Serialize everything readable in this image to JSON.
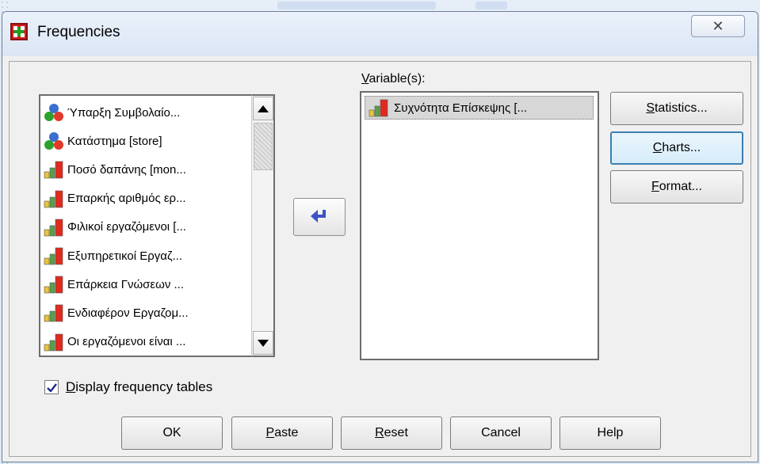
{
  "window": {
    "title": "Frequencies",
    "close_glyph": "✕"
  },
  "source_list": {
    "items": [
      {
        "label": "Ύπαρξη Συμβολαίο...",
        "icon": "nominal-variable-icon"
      },
      {
        "label": "Κατάστημα [store]",
        "icon": "nominal-variable-icon"
      },
      {
        "label": "Ποσό δαπάνης [mon...",
        "icon": "ordinal-variable-icon"
      },
      {
        "label": "Επαρκής αριθμός ερ...",
        "icon": "ordinal-variable-icon"
      },
      {
        "label": "Φιλικοί εργαζόμενοι [...",
        "icon": "ordinal-variable-icon"
      },
      {
        "label": "Εξυπηρετικοί Εργαζ...",
        "icon": "ordinal-variable-icon"
      },
      {
        "label": "Επάρκεια Γνώσεων ...",
        "icon": "ordinal-variable-icon"
      },
      {
        "label": "Ενδιαφέρον Εργαζομ...",
        "icon": "ordinal-variable-icon"
      },
      {
        "label": "Οι εργαζόμενοι είναι ...",
        "icon": "ordinal-variable-icon"
      }
    ]
  },
  "variables": {
    "label_u": "V",
    "label_rest": "ariable(s):",
    "items": [
      {
        "label": "Συχνότητα Επίσκεψης [...",
        "icon": "ordinal-variable-icon"
      }
    ]
  },
  "side_buttons": {
    "statistics": {
      "u": "S",
      "rest": "tatistics..."
    },
    "charts": {
      "u": "C",
      "rest": "harts..."
    },
    "format": {
      "u": "F",
      "rest": "ormat..."
    }
  },
  "checkbox": {
    "u": "D",
    "rest": "isplay frequency tables",
    "checked": true
  },
  "bottom_buttons": {
    "ok": "OK",
    "paste": {
      "u": "P",
      "rest": "aste"
    },
    "reset": {
      "u": "R",
      "rest": "eset"
    },
    "cancel": "Cancel",
    "help": "Help"
  }
}
